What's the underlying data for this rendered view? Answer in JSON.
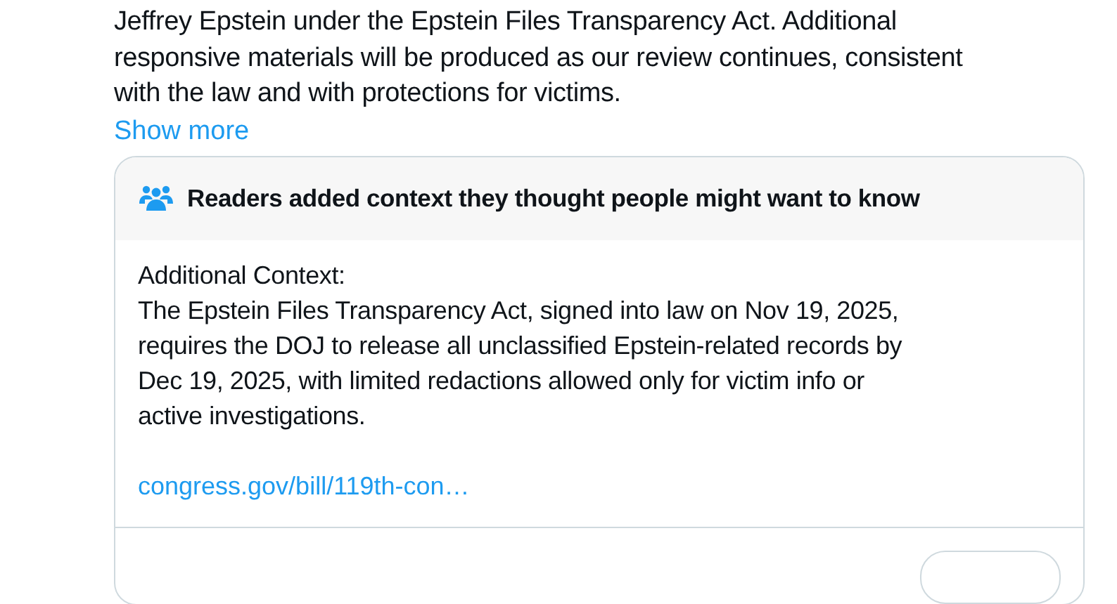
{
  "post": {
    "text": "Jeffrey Epstein under the Epstein Files Transparency Act. Additional\nresponsive materials will be produced as our review continues, consistent\nwith the law and with protections for victims.",
    "show_more": "Show more"
  },
  "context_note": {
    "heading": "Readers added context they thought people might want to know",
    "body": "Additional Context:\nThe Epstein Files Transparency Act, signed into law on Nov 19, 2025,\nrequires the DOJ to release all unclassified Epstein-related records by\nDec 19, 2025, with limited redactions allowed only for victim info or\nactive investigations.",
    "link": "congress.gov/bill/119th-con…"
  }
}
